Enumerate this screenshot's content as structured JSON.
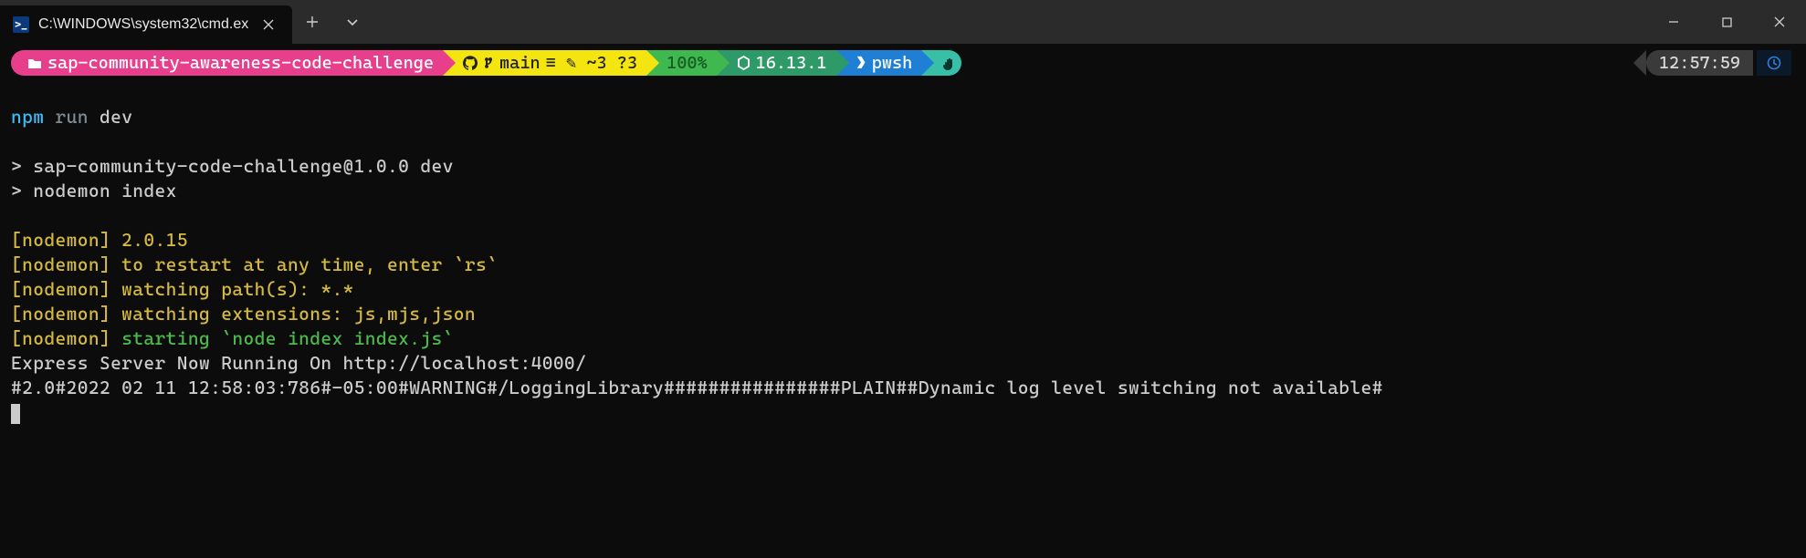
{
  "titlebar": {
    "tab_title": "C:\\WINDOWS\\system32\\cmd.ex",
    "tab_icon_glyph": ">_"
  },
  "prompt": {
    "path": "sap-community-awareness-code-challenge",
    "git_branch": "main",
    "git_status": "≡  ✎ ~3 ?3",
    "battery": "100%",
    "node_version": "16.13.1",
    "shell": "pwsh"
  },
  "clock": {
    "time": "12:57:59"
  },
  "terminal": {
    "cmd_npm": "npm",
    "cmd_run": "run",
    "cmd_dev": "dev",
    "line_script1": "> sap-community-code-challenge@1.0.0 dev",
    "line_script2": "> nodemon index",
    "nodemon_lines": [
      "[nodemon] 2.0.15",
      "[nodemon] to restart at any time, enter `rs`",
      "[nodemon] watching path(s): *.*",
      "[nodemon] watching extensions: js,mjs,json"
    ],
    "nodemon_start_prefix": "[nodemon] ",
    "nodemon_start_rest": "starting `node index index.js`",
    "express_line": "Express Server Now Running On http://localhost:4000/",
    "warning_line": "#2.0#2022 02 11 12:58:03:786#-05:00#WARNING#/LoggingLibrary################PLAIN##Dynamic log level switching not available#"
  }
}
